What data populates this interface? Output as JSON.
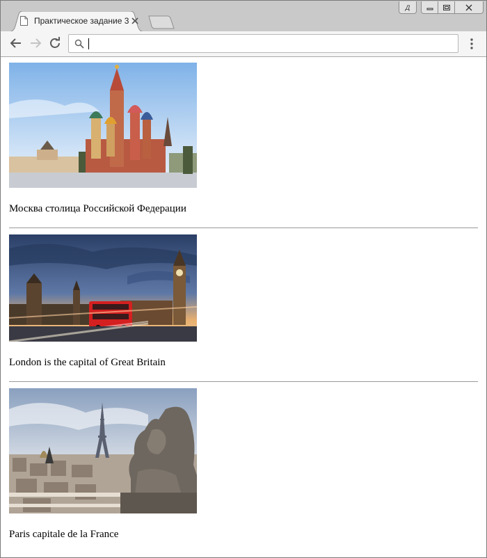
{
  "browser": {
    "tab_title": "Практическое задание 3",
    "user_badge": "Д",
    "address_value": ""
  },
  "page": {
    "items": [
      {
        "caption": "Москва столица Российской Федерации",
        "image": "saint-basils-cathedral-moscow"
      },
      {
        "caption": "London is the capital of Great Britain",
        "image": "london-big-ben-red-bus"
      },
      {
        "caption": "Paris capitale de la France",
        "image": "paris-eiffel-tower-gargoyle"
      }
    ]
  },
  "colors": {
    "tabstrip": "#c9c9c9",
    "toolbar": "#f5f5f5",
    "divider": "#9a9a9a"
  }
}
